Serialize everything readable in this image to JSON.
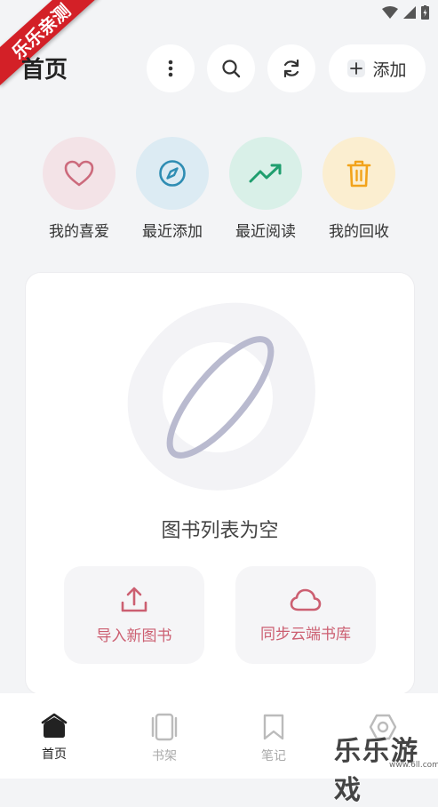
{
  "header": {
    "title": "首页",
    "add_label": "添加"
  },
  "quick_links": [
    {
      "label": "我的喜爱",
      "icon": "heart-icon",
      "bg": "#f3e3e7",
      "color": "#cc6a7c"
    },
    {
      "label": "最近添加",
      "icon": "compass-icon",
      "bg": "#dcebf3",
      "color": "#2f8db3"
    },
    {
      "label": "最近阅读",
      "icon": "trending-up-icon",
      "bg": "#d9f0e8",
      "color": "#1f9e6e"
    },
    {
      "label": "我的回收",
      "icon": "trash-icon",
      "bg": "#fbeed0",
      "color": "#f2a31b"
    }
  ],
  "empty_state": {
    "message": "图书列表为空",
    "import_label": "导入新图书",
    "sync_label": "同步云端书库"
  },
  "bottom_nav": [
    {
      "label": "首页",
      "icon": "home-icon",
      "active": true
    },
    {
      "label": "书架",
      "icon": "bookshelf-icon",
      "active": false
    },
    {
      "label": "笔记",
      "icon": "bookmark-icon",
      "active": false
    }
  ],
  "watermark": {
    "top": "乐乐亲测",
    "bottom": "乐乐游戏",
    "url": "www.6ll.com"
  },
  "colors": {
    "accent": "#cc5f71",
    "background": "#f3f4f6"
  }
}
